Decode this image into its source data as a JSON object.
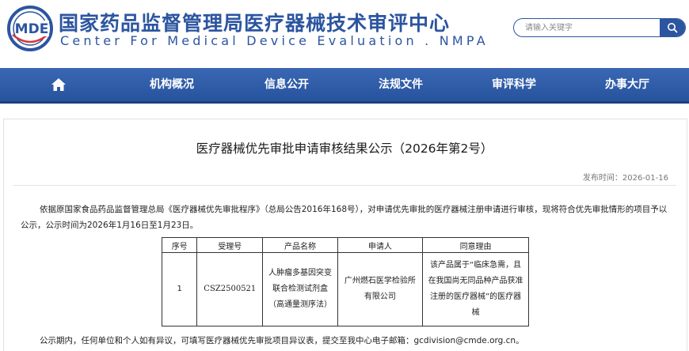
{
  "header": {
    "logo_text": "MDE",
    "title_cn": "国家药品监督管理局医疗器械技术审评中心",
    "title_en": "Center For Medical Device Evaluation . NMPA"
  },
  "search": {
    "placeholder": "请输入关键字",
    "icon": "search-icon"
  },
  "nav": {
    "home_icon": "home-icon",
    "items": [
      "机构概况",
      "信息公开",
      "法规文件",
      "审评科学",
      "办事大厅"
    ]
  },
  "article": {
    "title": "医疗器械优先审批申请审核结果公示（2026年第2号）",
    "publish_label": "发布时间：",
    "publish_date": "2026-01-16",
    "intro": "依据原国家食品药品监督管理总局《医疗器械优先审批程序》（总局公告2016年168号），对申请优先审批的医疗器械注册申请进行审核，现将符合优先审批情形的项目予以公示，公示时间为2026年1月16日至1月23日。",
    "table": {
      "headers": [
        "序号",
        "受理号",
        "产品名称",
        "申请人",
        "同意理由"
      ],
      "rows": [
        [
          "1",
          "CSZ2500521",
          "人肿瘤多基因突变联合检测试剂盒（高通量测序法）",
          "广州燃石医学检验所有限公司",
          "该产品属于“临床急需，且在我国尚无同品种产品获准注册的医疗器械”的医疗器械"
        ]
      ]
    },
    "footer": "公示期内，任何单位和个人如有异议，可填写医疗器械优先审批项目异议表，提交至我中心电子邮箱：gcdivision@cmde.org.cn。"
  },
  "colors": {
    "brand_blue": "#2c55a0",
    "nav_blue": "#3a67b3"
  }
}
